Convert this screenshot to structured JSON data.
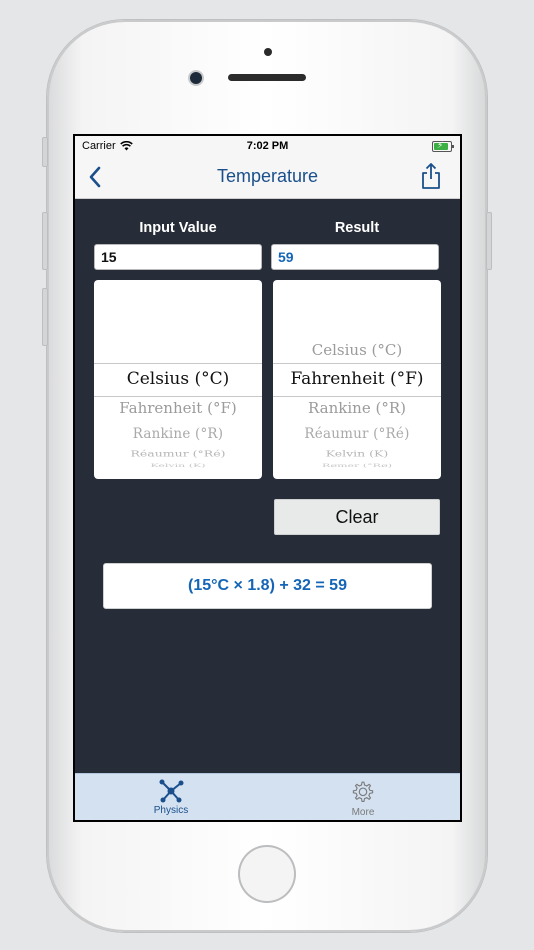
{
  "status_bar": {
    "carrier": "Carrier",
    "time": "7:02 PM"
  },
  "nav": {
    "title": "Temperature",
    "back_icon": "chevron-left-icon",
    "share_icon": "share-icon"
  },
  "input": {
    "label": "Input Value",
    "value": "15"
  },
  "result": {
    "label": "Result",
    "value": "59"
  },
  "from_picker": {
    "above": [],
    "selected": "Celsius (°C)",
    "below": [
      "Fahrenheit (°F)",
      "Rankine (°R)",
      "Réaumur (°Ré)",
      "Kelvin (K)"
    ]
  },
  "to_picker": {
    "above": [
      "Celsius (°C)"
    ],
    "selected": "Fahrenheit (°F)",
    "below": [
      "Rankine (°R)",
      "Réaumur (°Ré)",
      "Kelvin (K)",
      "Rømer (°Rø)"
    ]
  },
  "clear_button": "Clear",
  "formula": "(15°C × 1.8) + 32 = 59",
  "tabbar": {
    "items": [
      {
        "label": "Physics",
        "icon": "molecule-icon",
        "active": true
      },
      {
        "label": "More",
        "icon": "gear-icon",
        "active": false
      }
    ]
  },
  "colors": {
    "accent": "#1a4f8b",
    "result_text": "#1565b7",
    "background": "#272d38",
    "tabbar": "#d3e1f1"
  }
}
